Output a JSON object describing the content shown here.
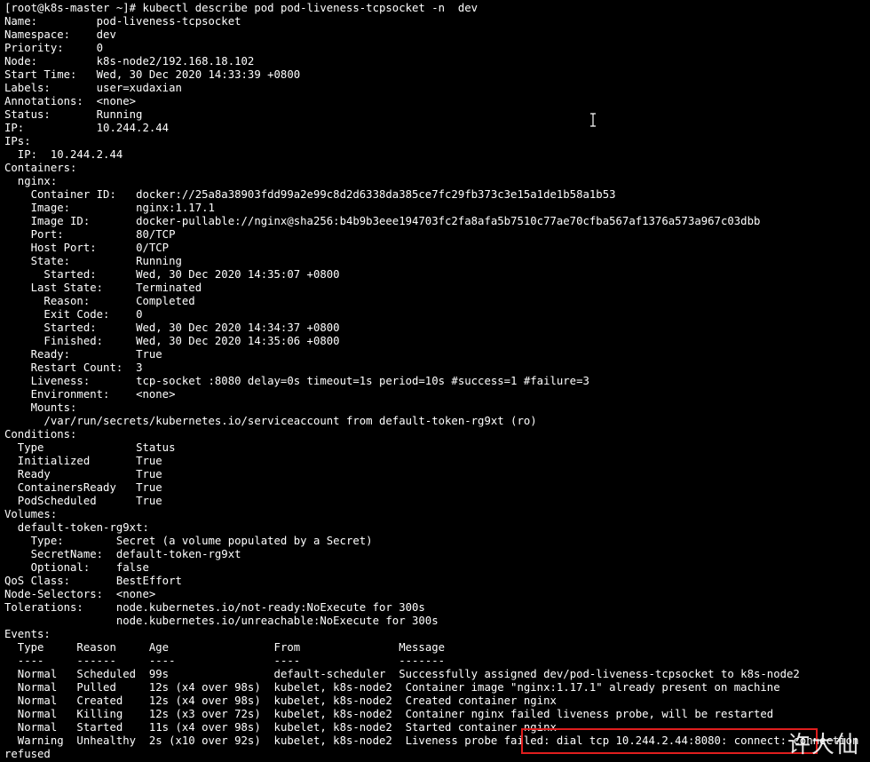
{
  "terminal": {
    "lines": [
      {
        "t": "[root@k8s-master ~]# kubectl describe pod pod-liveness-tcpsocket -n  dev"
      },
      {
        "k": "Name:",
        "c": 14,
        "v": "pod-liveness-tcpsocket"
      },
      {
        "k": "Namespace:",
        "c": 14,
        "v": "dev"
      },
      {
        "k": "Priority:",
        "c": 14,
        "v": "0"
      },
      {
        "k": "Node:",
        "c": 14,
        "v": "k8s-node2/192.168.18.102"
      },
      {
        "k": "Start Time:",
        "c": 14,
        "v": "Wed, 30 Dec 2020 14:33:39 +0800"
      },
      {
        "k": "Labels:",
        "c": 14,
        "v": "user=xudaxian"
      },
      {
        "k": "Annotations:",
        "c": 14,
        "v": "<none>"
      },
      {
        "k": "Status:",
        "c": 14,
        "v": "Running"
      },
      {
        "k": "IP:",
        "c": 14,
        "v": "10.244.2.44"
      },
      {
        "t": "IPs:"
      },
      {
        "t": "  IP:  10.244.2.44"
      },
      {
        "t": "Containers:"
      },
      {
        "t": "  nginx:"
      },
      {
        "k": "    Container ID:",
        "c": 20,
        "v": "docker://25a8a38903fdd99a2e99c8d2d6338da385ce7fc29fb373c3e15a1de1b58a1b53"
      },
      {
        "k": "    Image:",
        "c": 20,
        "v": "nginx:1.17.1"
      },
      {
        "k": "    Image ID:",
        "c": 20,
        "v": "docker-pullable://nginx@sha256:b4b9b3eee194703fc2fa8afa5b7510c77ae70cfba567af1376a573a967c03dbb"
      },
      {
        "k": "    Port:",
        "c": 20,
        "v": "80/TCP"
      },
      {
        "k": "    Host Port:",
        "c": 20,
        "v": "0/TCP"
      },
      {
        "k": "    State:",
        "c": 20,
        "v": "Running"
      },
      {
        "k": "      Started:",
        "c": 20,
        "v": "Wed, 30 Dec 2020 14:35:07 +0800"
      },
      {
        "k": "    Last State:",
        "c": 20,
        "v": "Terminated"
      },
      {
        "k": "      Reason:",
        "c": 20,
        "v": "Completed"
      },
      {
        "k": "      Exit Code:",
        "c": 20,
        "v": "0"
      },
      {
        "k": "      Started:",
        "c": 20,
        "v": "Wed, 30 Dec 2020 14:34:37 +0800"
      },
      {
        "k": "      Finished:",
        "c": 20,
        "v": "Wed, 30 Dec 2020 14:35:06 +0800"
      },
      {
        "k": "    Ready:",
        "c": 20,
        "v": "True"
      },
      {
        "k": "    Restart Count:",
        "c": 20,
        "v": "3"
      },
      {
        "k": "    Liveness:",
        "c": 20,
        "v": "tcp-socket :8080 delay=0s timeout=1s period=10s #success=1 #failure=3"
      },
      {
        "k": "    Environment:",
        "c": 20,
        "v": "<none>"
      },
      {
        "t": "    Mounts:"
      },
      {
        "t": "      /var/run/secrets/kubernetes.io/serviceaccount from default-token-rg9xt (ro)"
      },
      {
        "t": "Conditions:"
      },
      {
        "k": "  Type",
        "c": 20,
        "v": "Status"
      },
      {
        "k": "  Initialized",
        "c": 20,
        "v": "True"
      },
      {
        "k": "  Ready",
        "c": 20,
        "v": "True"
      },
      {
        "k": "  ContainersReady",
        "c": 20,
        "v": "True"
      },
      {
        "k": "  PodScheduled",
        "c": 20,
        "v": "True"
      },
      {
        "t": "Volumes:"
      },
      {
        "t": "  default-token-rg9xt:"
      },
      {
        "k": "    Type:",
        "c": 17,
        "v": "Secret (a volume populated by a Secret)"
      },
      {
        "k": "    SecretName:",
        "c": 17,
        "v": "default-token-rg9xt"
      },
      {
        "k": "    Optional:",
        "c": 17,
        "v": "false"
      },
      {
        "k": "QoS Class:",
        "c": 17,
        "v": "BestEffort"
      },
      {
        "k": "Node-Selectors:",
        "c": 17,
        "v": "<none>"
      },
      {
        "k": "Tolerations:",
        "c": 17,
        "v": "node.kubernetes.io/not-ready:NoExecute for 300s"
      },
      {
        "k": "",
        "c": 17,
        "v": "node.kubernetes.io/unreachable:NoExecute for 300s"
      },
      {
        "t": "Events:"
      },
      {
        "t": "  Type     Reason     Age                From               Message"
      },
      {
        "t": "  ----     ------     ----               ----               -------"
      },
      {
        "t": "  Normal   Scheduled  99s                default-scheduler  Successfully assigned dev/pod-liveness-tcpsocket to k8s-node2"
      },
      {
        "t": "  Normal   Pulled     12s (x4 over 98s)  kubelet, k8s-node2  Container image \"nginx:1.17.1\" already present on machine"
      },
      {
        "t": "  Normal   Created    12s (x4 over 98s)  kubelet, k8s-node2  Created container nginx"
      },
      {
        "t": "  Normal   Killing    12s (x3 over 72s)  kubelet, k8s-node2  Container nginx failed liveness probe, will be restarted"
      },
      {
        "t": "  Normal   Started    11s (x4 over 98s)  kubelet, k8s-node2  Started container nginx"
      },
      {
        "t": "  Warning  Unhealthy  2s (x10 over 92s)  kubelet, k8s-node2  Liveness probe failed: dial tcp 10.244.2.44:8080: connect: connection"
      },
      {
        "t": "refused"
      }
    ]
  },
  "watermark": {
    "text": "许大仙"
  },
  "colors": {
    "background": "#000000",
    "foreground": "#ffffff",
    "highlight_border": "#e01e1e"
  },
  "icons": {
    "cursor": "text-cursor-icon"
  }
}
